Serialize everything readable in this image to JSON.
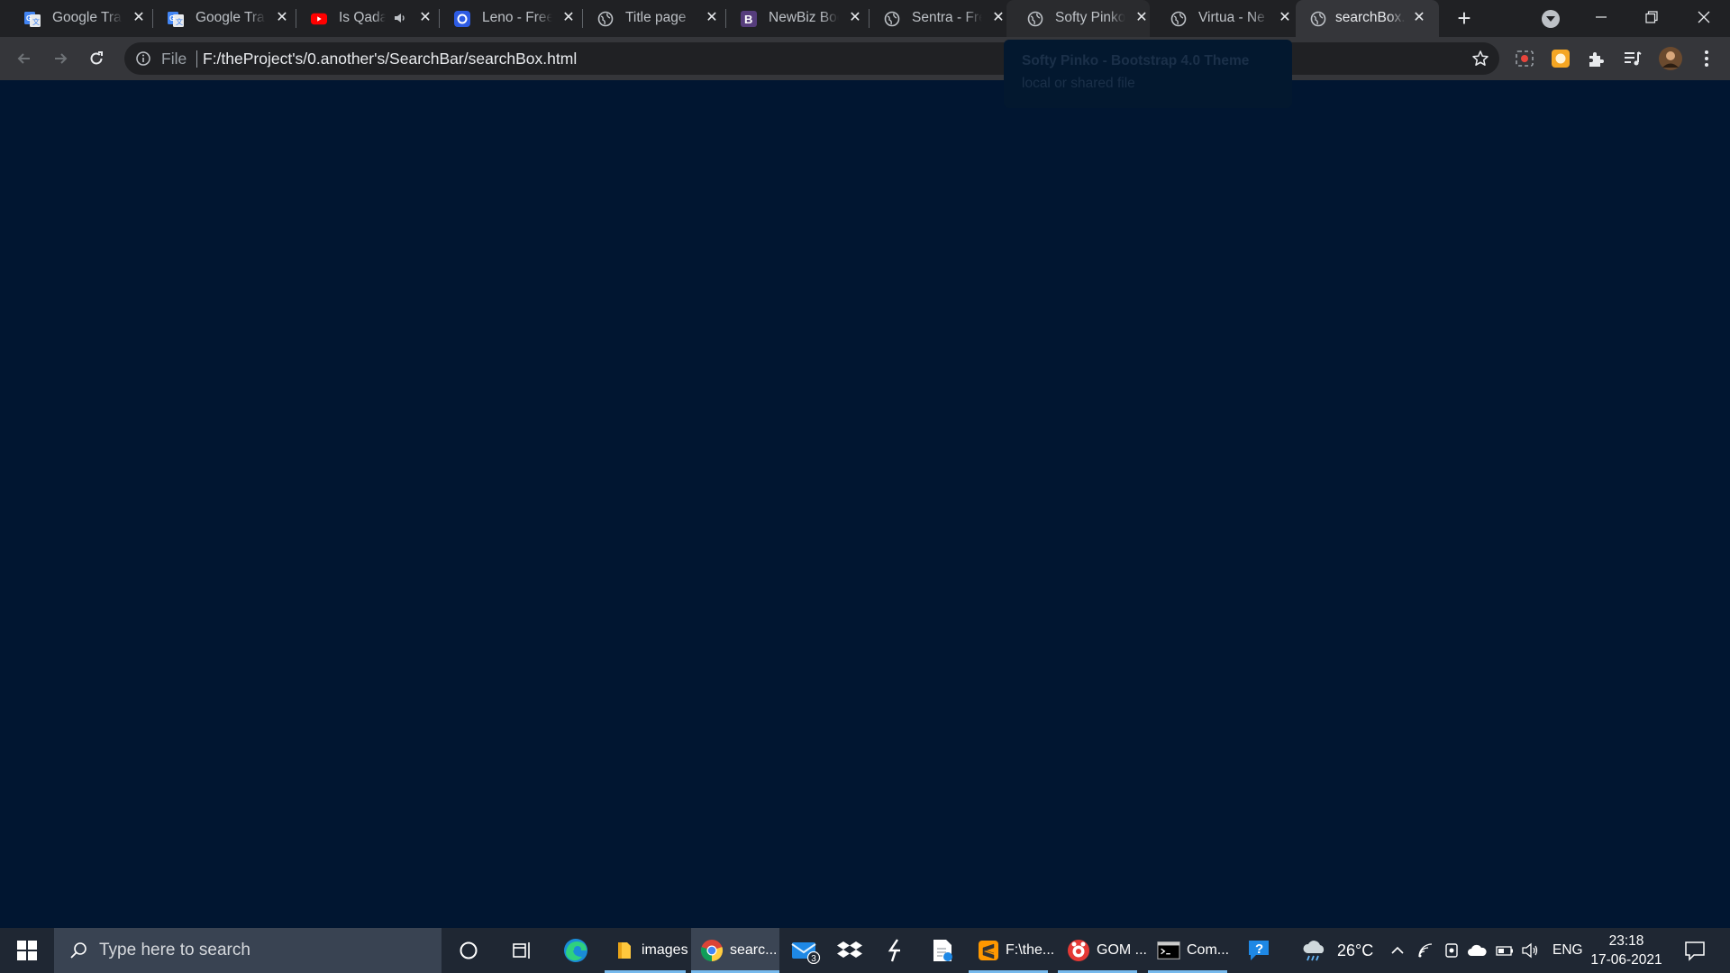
{
  "browser": {
    "tabs": [
      {
        "title": "Google Translate",
        "favicon": "google-translate-icon",
        "active": false
      },
      {
        "title": "Google Translate",
        "favicon": "google-translate-icon",
        "active": false
      },
      {
        "title": "Is Qada",
        "favicon": "youtube-icon",
        "active": false,
        "audio": true
      },
      {
        "title": "Leno - Free",
        "favicon": "leno-icon",
        "active": false
      },
      {
        "title": "Title page",
        "favicon": "globe-icon",
        "active": false
      },
      {
        "title": "NewBiz Boo",
        "favicon": "bootstrap-icon",
        "active": false
      },
      {
        "title": "Sentra - Fre",
        "favicon": "globe-icon",
        "active": false
      },
      {
        "title": "Softy Pinko",
        "favicon": "globe-icon",
        "active": false,
        "hovered": true
      },
      {
        "title": "Virtua - Ne",
        "favicon": "globe-icon",
        "active": false
      },
      {
        "title": "searchBox.h",
        "favicon": "globe-icon",
        "active": true
      }
    ],
    "new_tab_label": "+",
    "omnibox": {
      "scheme": "File",
      "url": "F:/theProject's/0.another's/SearchBar/searchBox.html"
    },
    "hover_card": {
      "title": "Softy Pinko - Bootstrap 4.0 Theme",
      "subtitle": "local or shared file"
    }
  },
  "taskbar": {
    "search_placeholder": "Type here to search",
    "apps": [
      {
        "label": "images",
        "icon": "folder-icon"
      },
      {
        "label": "searc...",
        "icon": "chrome-icon"
      },
      {
        "label": "F:\\the...",
        "icon": "sublime-icon"
      },
      {
        "label": "GOM ...",
        "icon": "gom-player-icon"
      },
      {
        "label": "Com...",
        "icon": "command-prompt-icon"
      }
    ],
    "mail_badge": "3",
    "weather": "26°C",
    "language": "ENG",
    "time": "23:18",
    "date": "17-06-2021"
  },
  "colors": {
    "page_background": "#011631",
    "tabstrip": "#202124",
    "toolbar": "#35363a",
    "taskbar": "#1f2733"
  }
}
